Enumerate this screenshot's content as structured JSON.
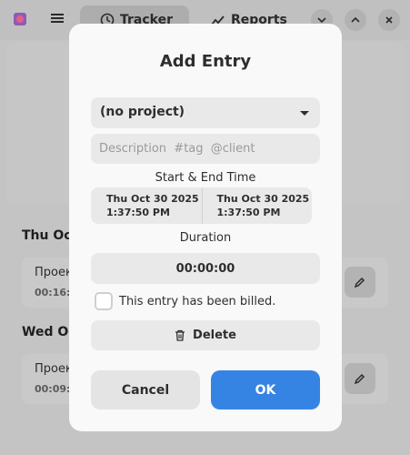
{
  "header": {
    "tab_tracker": "Tracker",
    "tab_reports": "Reports"
  },
  "background": {
    "day1": "Thu Oct",
    "day1_entry_name": "Проек",
    "day1_entry_duration": "00:16:0",
    "day2": "Wed Oct",
    "day2_entry_name": "Проек",
    "day2_entry_duration": "00:09:0"
  },
  "dialog": {
    "title": "Add Entry",
    "project_value": "(no project)",
    "description_placeholder": "Description  #tag  @client",
    "time_label": "Start & End Time",
    "start_date": "Thu Oct 30 2025",
    "start_time": "1:37:50 PM",
    "end_date": "Thu Oct 30 2025",
    "end_time": "1:37:50 PM",
    "duration_label": "Duration",
    "duration_value": "00:00:00",
    "billed_label": "This entry has been billed.",
    "delete_label": "Delete",
    "cancel_label": "Cancel",
    "ok_label": "OK"
  },
  "colors": {
    "accent": "#3584e4"
  }
}
